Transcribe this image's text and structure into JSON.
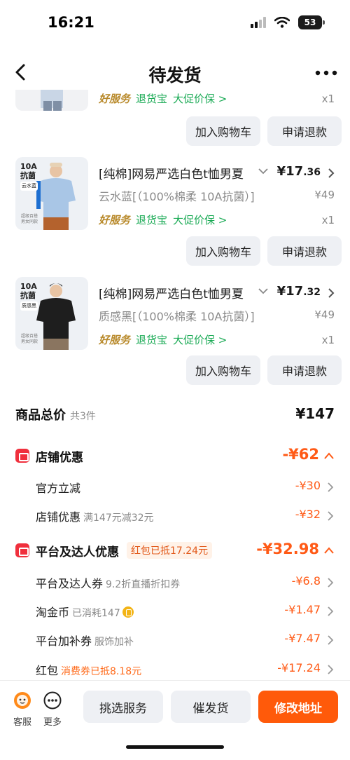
{
  "status": {
    "time": "16:21",
    "battery": "53"
  },
  "nav": {
    "title": "待发货"
  },
  "top_partial_item": {
    "tags": {
      "good": "好服务",
      "return": "退货宝",
      "promo": "大促价保 >"
    },
    "qty": "x1"
  },
  "buttons": {
    "add_cart": "加入购物车",
    "refund": "申请退款"
  },
  "products": [
    {
      "badge": "10A\n抗菌",
      "badge_sub": "云水蓝",
      "title": "[纯棉]网易严选白色t恤男夏",
      "price_int": "¥17",
      "price_dec": ".36",
      "spec": "云水蓝[（100%棉柔 10A抗菌）]",
      "orig_price": "¥49",
      "tags": {
        "good": "好服务",
        "return": "退货宝",
        "promo": "大促价保 >"
      },
      "qty": "x1",
      "shirt_color": "#a9c6e6"
    },
    {
      "badge": "10A\n抗菌",
      "badge_sub": "质感黑",
      "title": "[纯棉]网易严选白色t恤男夏",
      "price_int": "¥17",
      "price_dec": ".32",
      "spec": "质感黑[（100%棉柔 10A抗菌）]",
      "orig_price": "¥49",
      "tags": {
        "good": "好服务",
        "return": "退货宝",
        "promo": "大促价保 >"
      },
      "qty": "x1",
      "shirt_color": "#1e1e1e"
    }
  ],
  "thumb_footer": "超级百搭\n男女同款",
  "total": {
    "label": "商品总价",
    "count": "共3件",
    "value": "¥147"
  },
  "shop_discount": {
    "label": "店铺优惠",
    "value": "-¥62",
    "rows": [
      {
        "label": "官方立减",
        "note": "",
        "value": "-¥30"
      },
      {
        "label": "店铺优惠",
        "note": "满147元减32元",
        "value": "-¥32"
      }
    ]
  },
  "platform_discount": {
    "label": "平台及达人优惠",
    "pill": "红包已抵17.24元",
    "value": "-¥32.98",
    "rows": [
      {
        "label": "平台及达人券",
        "note": "9.2折直播折扣券",
        "value": "-¥6.8"
      },
      {
        "label": "淘金币",
        "note": "已消耗147",
        "value": "-¥1.47"
      },
      {
        "label": "平台加补券",
        "note": "服饰加补",
        "value": "-¥7.47"
      },
      {
        "label": "红包",
        "note": "消费券已抵8.18元",
        "value": "-¥17.24"
      }
    ]
  },
  "bottom": {
    "service": "客服",
    "more": "更多",
    "pick_service": "挑选服务",
    "urge": "催发货",
    "modify_address": "修改地址"
  },
  "colors": {
    "accent": "#ff5a16",
    "green": "#1aaa55",
    "gold": "#b8892a"
  }
}
